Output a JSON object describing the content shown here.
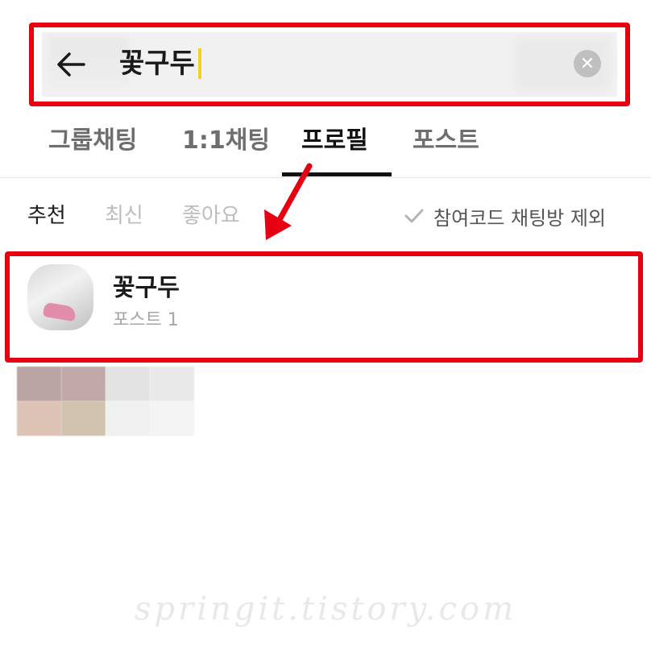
{
  "search": {
    "query": "꽃구두"
  },
  "tabs": [
    {
      "label": "그룹채팅",
      "active": false
    },
    {
      "label": "1:1채팅",
      "active": false
    },
    {
      "label": "프로필",
      "active": true
    },
    {
      "label": "포스트",
      "active": false
    }
  ],
  "filters": [
    {
      "label": "추천",
      "active": true
    },
    {
      "label": "최신",
      "active": false
    },
    {
      "label": "좋아요",
      "active": false
    }
  ],
  "exclude_option": {
    "label": "참여코드 채팅방 제외",
    "icon": "check-icon"
  },
  "result": {
    "name": "꽃구두",
    "subtitle": "포스트 1"
  },
  "watermark": "springit.tistory.com",
  "colors": {
    "annotation_red": "#e60012",
    "caret_yellow": "#f5d21b",
    "active_text": "#121212",
    "inactive_text": "#6e6e6e"
  },
  "icons": [
    "back-arrow-icon",
    "clear-icon",
    "check-icon",
    "red-arrow-annotation"
  ]
}
